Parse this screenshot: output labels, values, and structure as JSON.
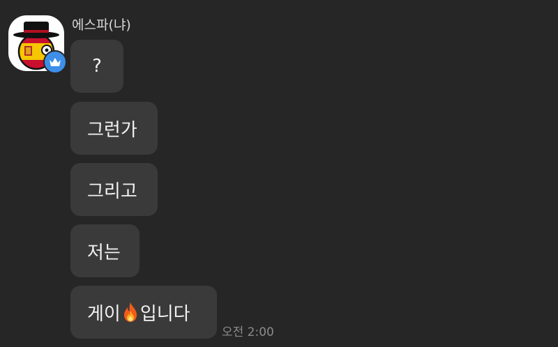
{
  "chat": {
    "sender_name": "에스파(냐)",
    "avatar_icon": "spain-countryball-avatar",
    "badge_icon": "crown-icon",
    "badge_color": "#3d8fe8",
    "messages": [
      {
        "text": "?"
      },
      {
        "text": "그런가"
      },
      {
        "text": "그리고"
      },
      {
        "text": "저는"
      },
      {
        "text_before": "게이",
        "emoji": "fire-emoji",
        "text_after": "입니다"
      }
    ],
    "timestamp": "오전 2:00"
  },
  "colors": {
    "background": "#262626",
    "bubble": "#3a3a3a",
    "text": "#f2f2f2",
    "timestamp": "#8c8c8c"
  }
}
